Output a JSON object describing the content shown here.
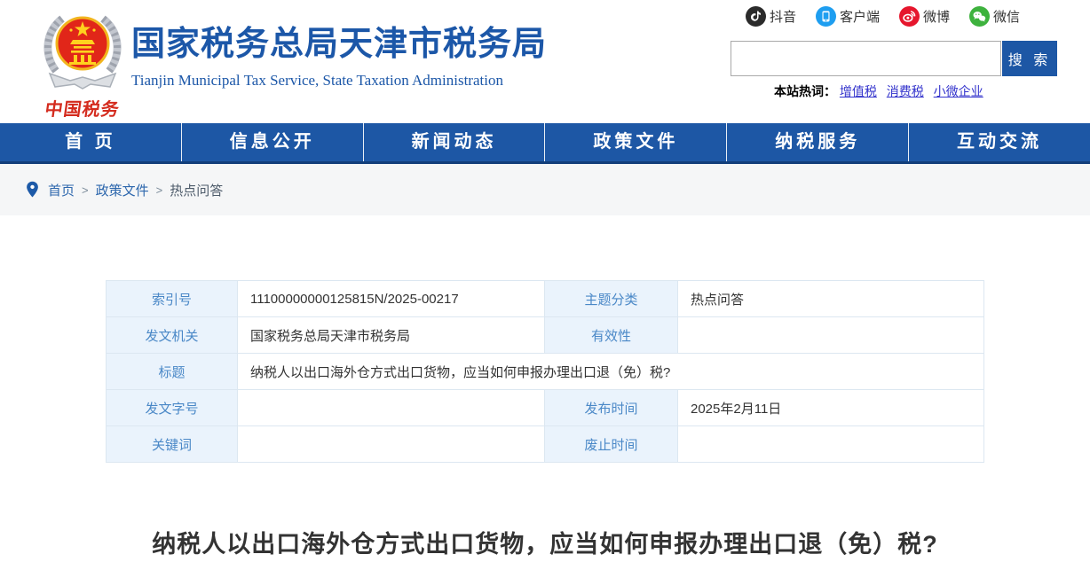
{
  "header": {
    "title": "国家税务总局天津市税务局",
    "subtitle": "Tianjin Municipal Tax Service, State Taxation Administration",
    "logo_caption": "中国税务",
    "social": [
      {
        "name": "douyin",
        "label": "抖音",
        "color": "#2b2b2b"
      },
      {
        "name": "client-app",
        "label": "客户端",
        "color": "#1e9ef0"
      },
      {
        "name": "weibo",
        "label": "微博",
        "color": "#e6162d"
      },
      {
        "name": "wechat",
        "label": "微信",
        "color": "#3eb23e"
      }
    ],
    "search": {
      "value": "",
      "button_label": "搜 索"
    },
    "hotwords": {
      "label": "本站热词：",
      "links": [
        "增值税",
        "消费税",
        "小微企业"
      ]
    }
  },
  "nav": {
    "items": [
      "首 页",
      "信息公开",
      "新闻动态",
      "政策文件",
      "纳税服务",
      "互动交流"
    ]
  },
  "breadcrumb": {
    "separator": ">",
    "items": [
      "首页",
      "政策文件",
      "热点问答"
    ]
  },
  "meta_table": {
    "index_label": "索引号",
    "index_value": "11100000000125815N/2025-00217",
    "topic_label": "主题分类",
    "topic_value": "热点问答",
    "issuer_label": "发文机关",
    "issuer_value": "国家税务总局天津市税务局",
    "validity_label": "有效性",
    "validity_value": "",
    "title_label": "标题",
    "title_value": "纳税人以出口海外仓方式出口货物，应当如何申报办理出口退（免）税?",
    "docnum_label": "发文字号",
    "docnum_value": "",
    "pubdate_label": "发布时间",
    "pubdate_value": "2025年2月11日",
    "keywords_label": "关键词",
    "keywords_value": "",
    "repeal_label": "废止时间",
    "repeal_value": ""
  },
  "article": {
    "title": "纳税人以出口海外仓方式出口货物，应当如何申报办理出口退（免）税?"
  },
  "colors": {
    "primary_blue": "#1d57a5",
    "title_blue": "#1c57a8",
    "nav_border": "#123e7a",
    "label_cell_bg": "#eaf3fc",
    "label_cell_text": "#4a88c7",
    "link_blue": "#3333cc",
    "breadcrumb_bg": "#f5f6f7"
  }
}
